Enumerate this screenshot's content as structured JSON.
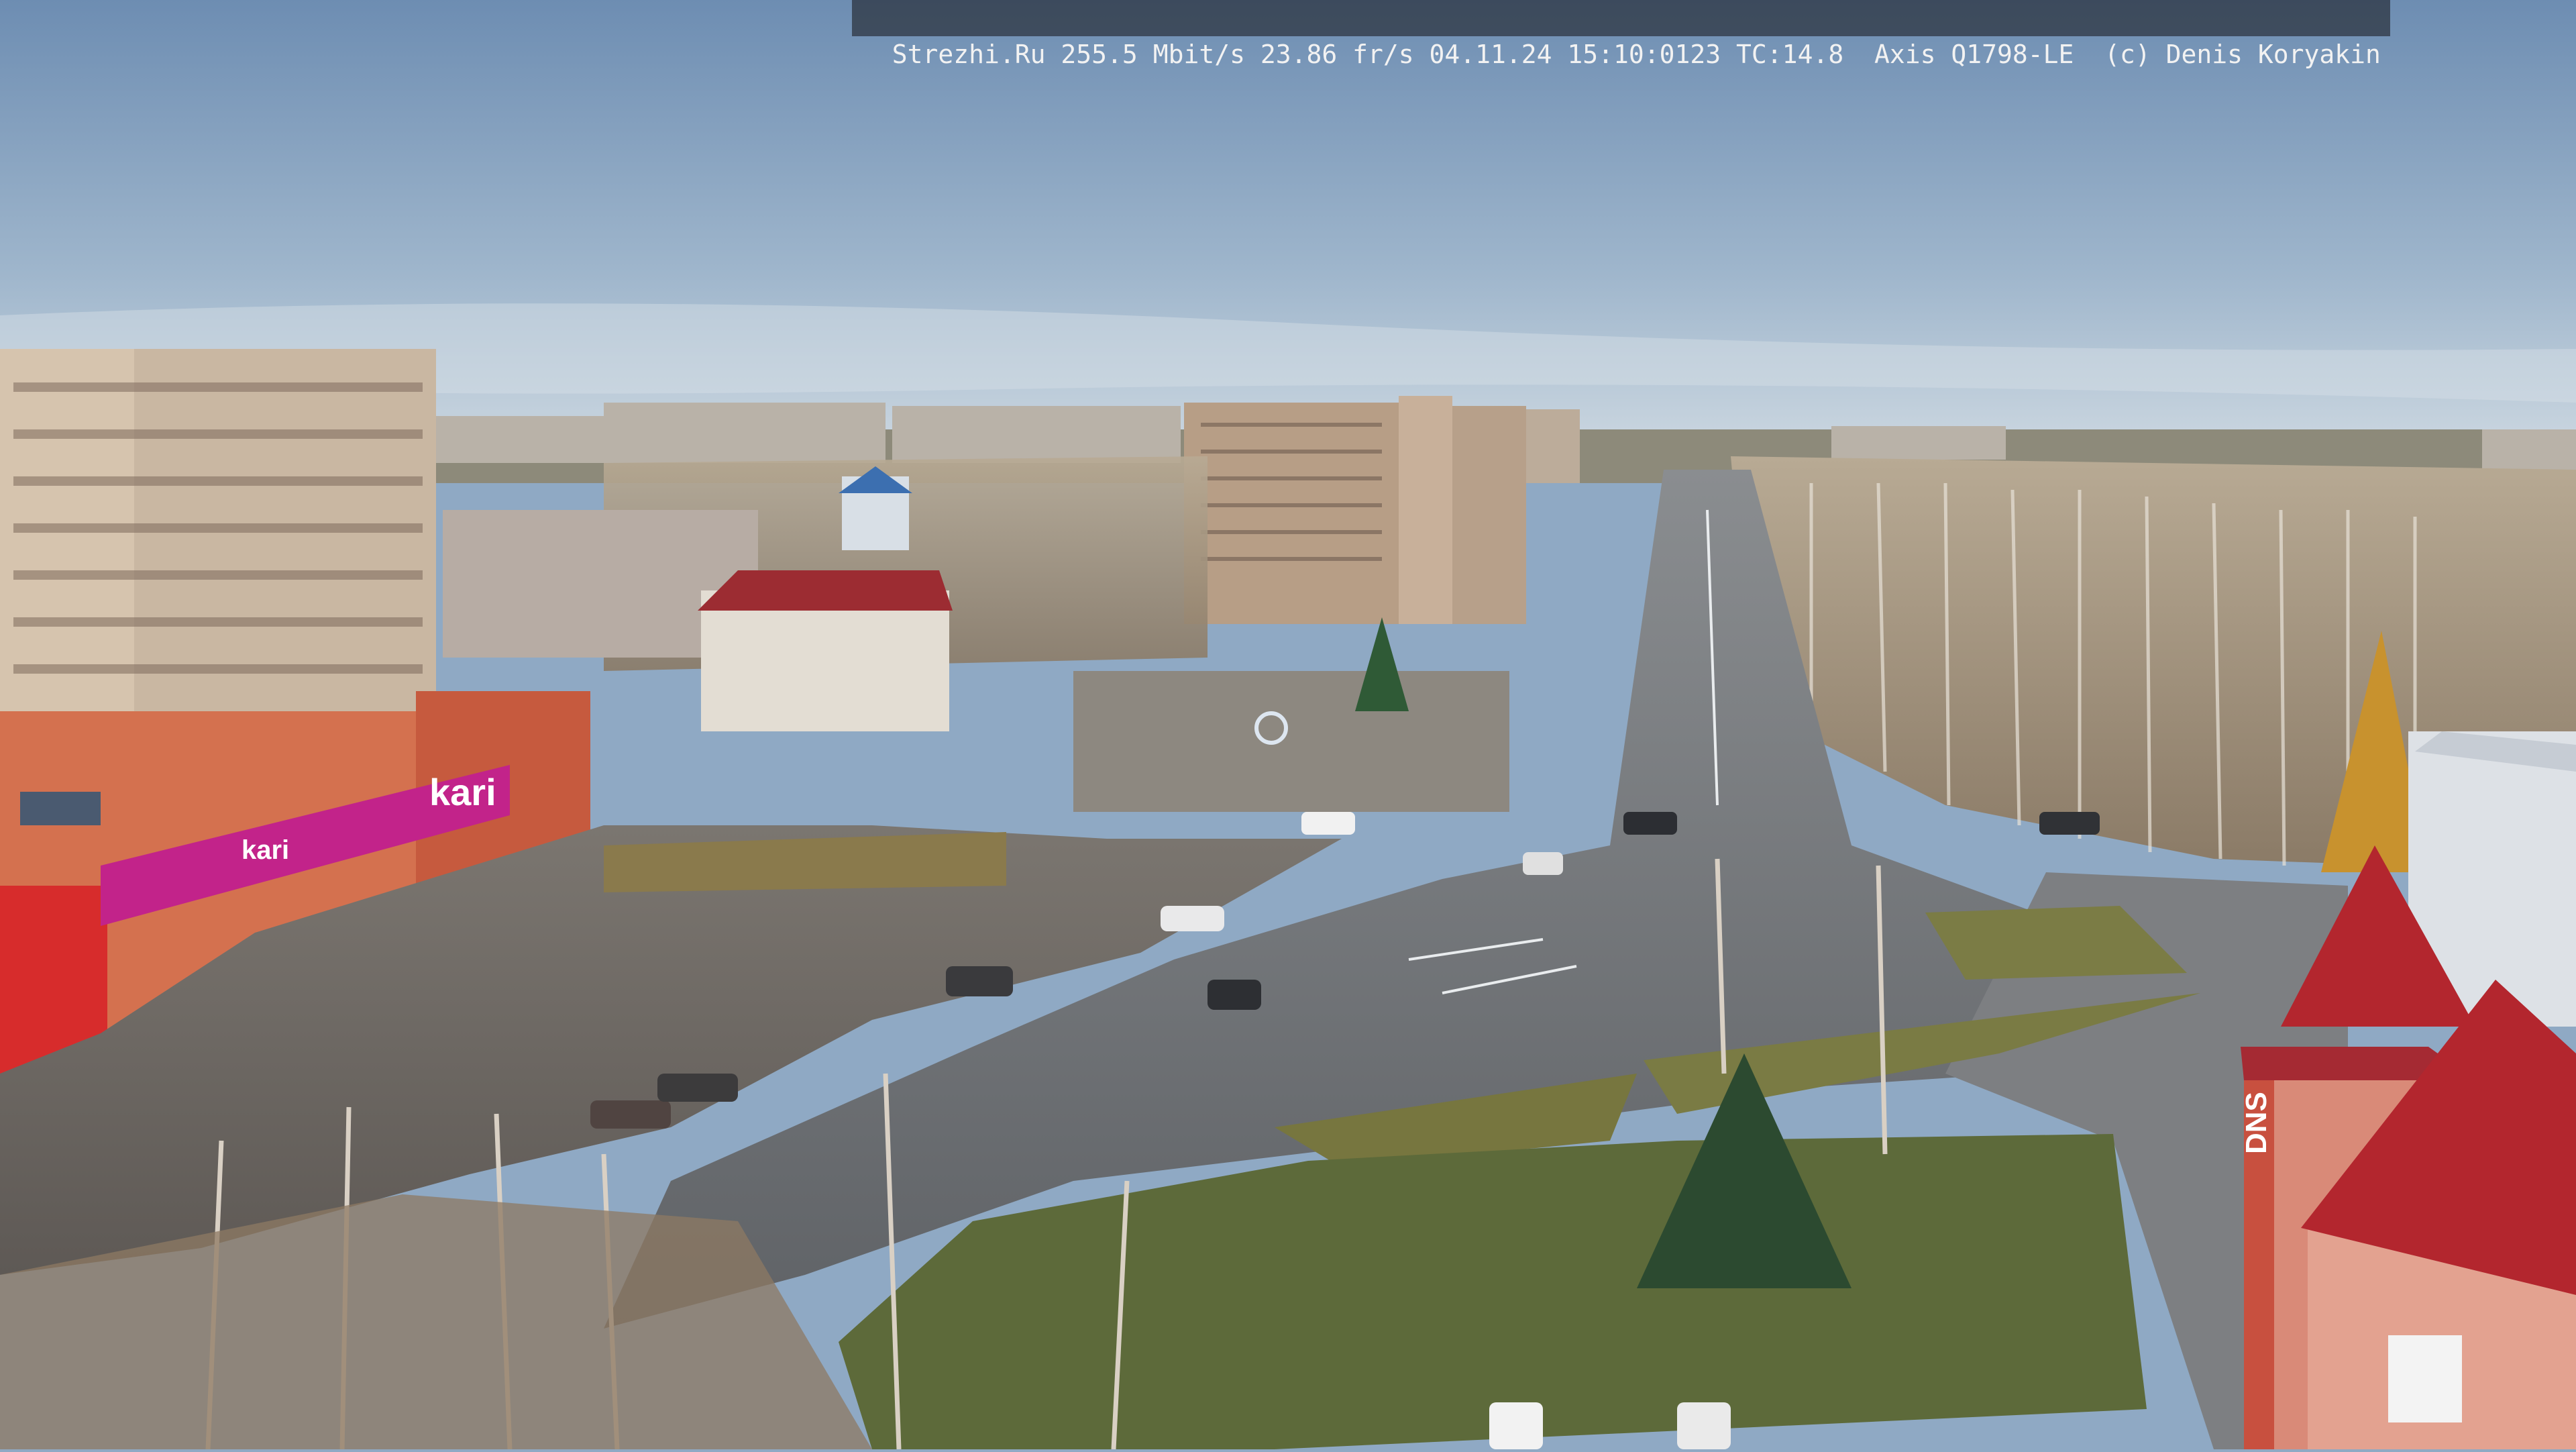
{
  "camera_overlay": {
    "text": "Strezhi.Ru 255.5 Mbit/s 23.86 fr/s 04.11.24 15:10:0123 TC:14.8  Axis Q1798-LE  (c) Denis Koryakin"
  },
  "signage": {
    "kari_large": "kari",
    "kari_small": "kari",
    "dns": "DNS"
  },
  "colors": {
    "sky_top": "#6f8fb3",
    "sky_horizon": "#c9d6e0",
    "road": "#6d7074",
    "grass": "#7e7a45",
    "kari_pink": "#c2238a",
    "roof_red": "#b3262e"
  }
}
